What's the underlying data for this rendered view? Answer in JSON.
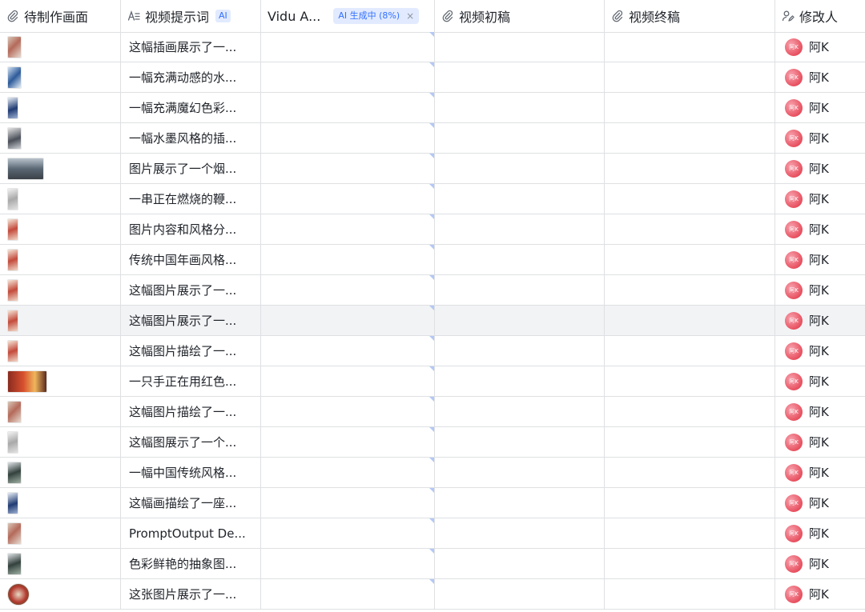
{
  "columns": {
    "image": "待制作画面",
    "prompt": "视频提示词",
    "prompt_ai_tag": "AI",
    "vidu": "Vidu A...",
    "vidu_status": "AI 生成中 (8%)",
    "vidu_status_close": "×",
    "draft": "视频初稿",
    "final": "视频终稿",
    "modifier": "修改人"
  },
  "colors": {
    "ai_accent": "#3370ff",
    "avatar": "#e8505f",
    "row_highlight": "#f2f3f5",
    "border": "#dee0e3"
  },
  "rows": [
    {
      "thumb": "portrait",
      "prompt": "这幅插画展示了一...",
      "avatar_text": "阿K",
      "modifier": "阿K"
    },
    {
      "thumb": "blue",
      "prompt": "一幅充满动感的水...",
      "avatar_text": "阿K",
      "modifier": "阿K"
    },
    {
      "thumb": "navy",
      "prompt": "一幅充满魔幻色彩...",
      "avatar_text": "阿K",
      "modifier": "阿K"
    },
    {
      "thumb": "ink",
      "prompt": "一幅水墨风格的插...",
      "avatar_text": "阿K",
      "modifier": "阿K"
    },
    {
      "thumb": "wide-landscape",
      "prompt": "图片展示了一个烟...",
      "avatar_text": "阿K",
      "modifier": "阿K"
    },
    {
      "thumb": "gray",
      "prompt": "一串正在燃烧的鞭...",
      "avatar_text": "阿K",
      "modifier": "阿K"
    },
    {
      "thumb": "red",
      "prompt": "图片内容和风格分...",
      "avatar_text": "阿K",
      "modifier": "阿K"
    },
    {
      "thumb": "red",
      "prompt": "传统中国年画风格...",
      "avatar_text": "阿K",
      "modifier": "阿K"
    },
    {
      "thumb": "red",
      "prompt": "这幅图片展示了一...",
      "avatar_text": "阿K",
      "modifier": "阿K"
    },
    {
      "thumb": "red",
      "prompt": "这幅图片展示了一...",
      "avatar_text": "阿K",
      "modifier": "阿K",
      "highlighted": true
    },
    {
      "thumb": "red",
      "prompt": "这幅图片描绘了一...",
      "avatar_text": "阿K",
      "modifier": "阿K"
    },
    {
      "thumb": "wide-red",
      "prompt": "一只手正在用红色...",
      "avatar_text": "阿K",
      "modifier": "阿K"
    },
    {
      "thumb": "portrait",
      "prompt": "这幅图片描绘了一...",
      "avatar_text": "阿K",
      "modifier": "阿K"
    },
    {
      "thumb": "gray",
      "prompt": "这幅图展示了一个...",
      "avatar_text": "阿K",
      "modifier": "阿K"
    },
    {
      "thumb": "dark",
      "prompt": "一幅中国传统风格...",
      "avatar_text": "阿K",
      "modifier": "阿K"
    },
    {
      "thumb": "navy",
      "prompt": "这幅画描绘了一座...",
      "avatar_text": "阿K",
      "modifier": "阿K"
    },
    {
      "thumb": "portrait",
      "prompt": "PromptOutput  De...",
      "avatar_text": "阿K",
      "modifier": "阿K"
    },
    {
      "thumb": "dark",
      "prompt": "色彩鲜艳的抽象图...",
      "avatar_text": "阿K",
      "modifier": "阿K"
    },
    {
      "thumb": "round",
      "prompt": "这张图片展示了一...",
      "avatar_text": "阿K",
      "modifier": "阿K"
    }
  ]
}
